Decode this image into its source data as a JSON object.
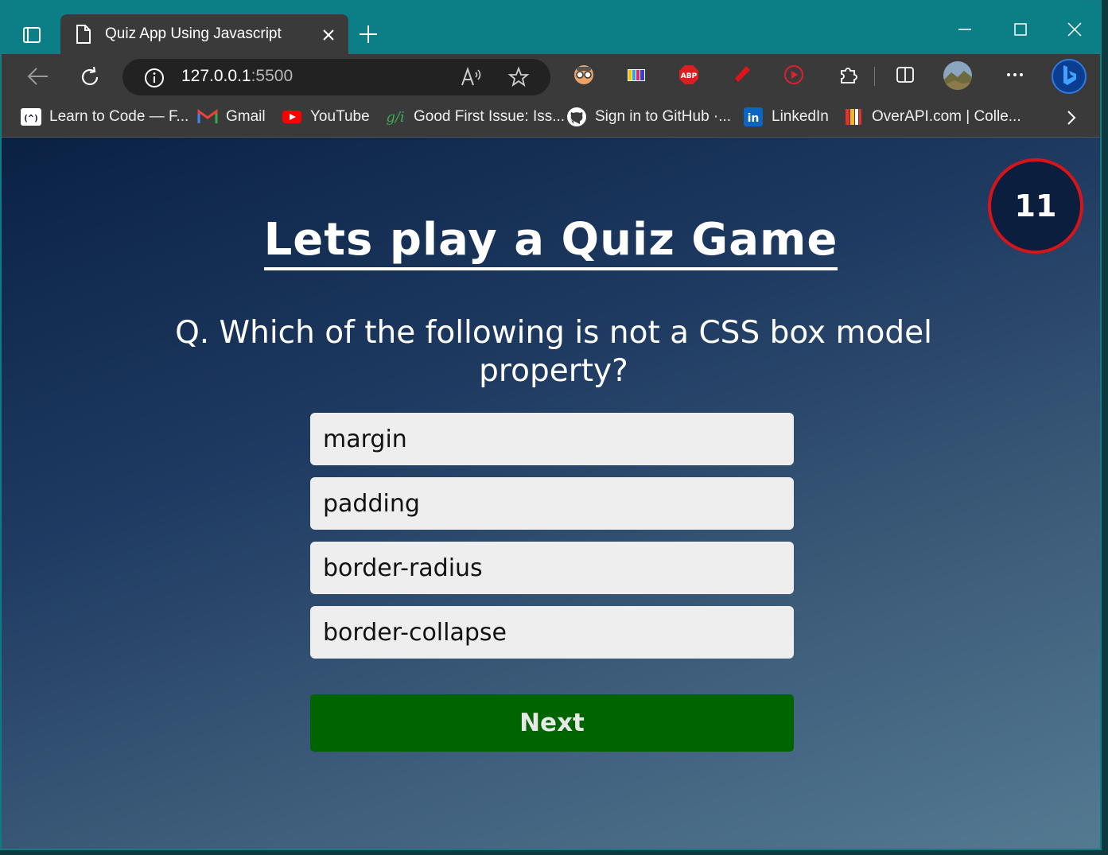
{
  "tab": {
    "title": "Quiz App Using Javascript"
  },
  "address": {
    "host": "127.0.0.1",
    "port": ":5500"
  },
  "bookmarks": [
    {
      "label": "Learn to Code — F..."
    },
    {
      "label": "Gmail"
    },
    {
      "label": "YouTube"
    },
    {
      "label": "Good First Issue: Iss..."
    },
    {
      "label": "Sign in to GitHub ·..."
    },
    {
      "label": "LinkedIn"
    },
    {
      "label": "OverAPI.com | Colle..."
    }
  ],
  "quiz": {
    "timer": "11",
    "heading": "Lets play a Quiz Game",
    "question": "Q. Which of the following is not a CSS box model property?",
    "options": [
      "margin",
      "padding",
      "border-radius",
      "border-collapse"
    ],
    "next_label": "Next"
  },
  "colors": {
    "titlebar": "#0b7f85",
    "next_button": "#006400",
    "timer_border": "#d91418"
  }
}
